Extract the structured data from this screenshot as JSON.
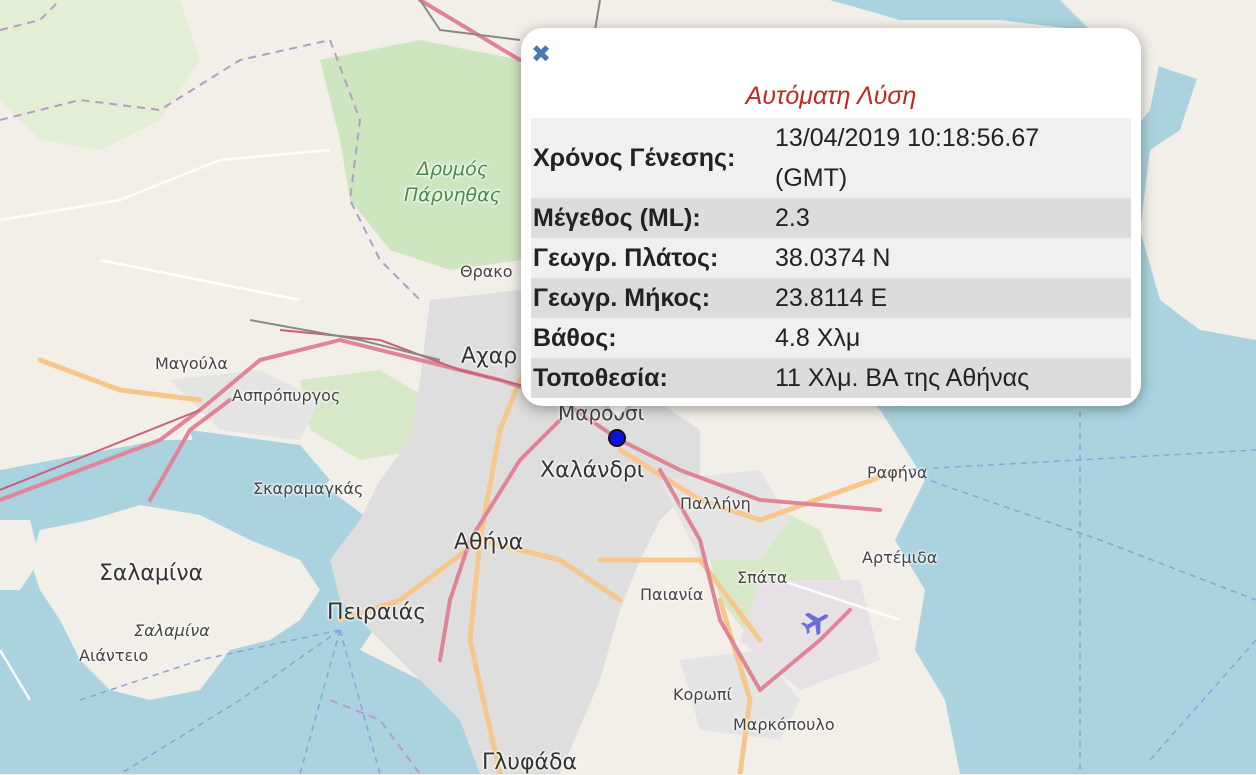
{
  "map": {
    "place_labels": {
      "drymos": "Δρυμός\nΠάρνηθας",
      "thrako": "Θρακο",
      "acharnes": "Αχαρ",
      "magoula": "Μαγούλα",
      "aspropyrgos": "Ασπρόπυργος",
      "marousi": "Μαρουσι",
      "chalandri": "Χαλάνδρι",
      "skaramangas": "Σκαραμαγκάς",
      "pallini": "Παλλήνη",
      "rafina": "Ραφήνα",
      "athina": "Αθήνα",
      "artemida": "Αρτέμιδα",
      "spata": "Σπάτα",
      "salamina_island": "Σαλαμίνα",
      "peiraias": "Πειραιάς",
      "salamina_town": "Σαλαμίνα",
      "paiania": "Παιανία",
      "aianteio": "Αιάντειο",
      "koropi": "Κορωπί",
      "markopoulo": "Μαρκόπουλο",
      "glyfada": "Γλυφάδα"
    },
    "colors": {
      "sea": "#aad3df",
      "land": "#f2efe9",
      "forest": "#cde6c0",
      "urban": "#dedede",
      "motorway": "#e892a2",
      "primary_road": "#fcd6a4",
      "epicenter": "#1010e0"
    }
  },
  "popup": {
    "close_icon": "✖",
    "title": "Αυτόματη Λύση",
    "rows": [
      {
        "label": "Χρόνος Γένεσης:",
        "value_line1": "13/04/2019 10:18:56.67",
        "value_line2": "(GMT)"
      },
      {
        "label": "Μέγεθος (ML):",
        "value": "2.3"
      },
      {
        "label": "Γεωγρ. Πλάτος:",
        "value": "38.0374 N"
      },
      {
        "label": "Γεωγρ. Μήκος:",
        "value": "23.8114 E"
      },
      {
        "label": "Βάθος:",
        "value": "4.8 Χλμ"
      },
      {
        "label": "Τοποθεσία:",
        "value": "11 Χλμ. ΒΑ της Αθήνας"
      }
    ]
  }
}
